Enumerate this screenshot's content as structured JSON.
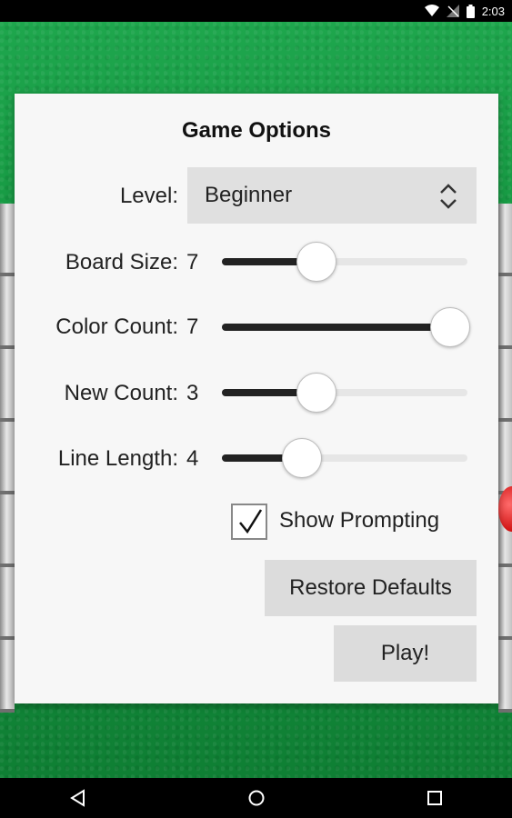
{
  "status_bar": {
    "time": "2:03"
  },
  "dialog": {
    "title": "Game Options",
    "level": {
      "label": "Level:",
      "value": "Beginner"
    },
    "board_size": {
      "label": "Board Size:",
      "value": "7",
      "level": 0.36
    },
    "color_count": {
      "label": "Color Count:",
      "value": "7",
      "level": 1.0
    },
    "new_count": {
      "label": "New Count:",
      "value": "3",
      "level": 0.36
    },
    "line_length": {
      "label": "Line Length:",
      "value": "4",
      "level": 0.29
    },
    "show_prompting": {
      "label": "Show Prompting",
      "checked": true
    },
    "restore_button": "Restore Defaults",
    "play_button": "Play!"
  },
  "colors": {
    "accent": "#222222",
    "dialog_bg": "#f7f7f7",
    "button_bg": "#dcdcdc",
    "felt": "#1ea64d"
  },
  "icons": {
    "level_dropdown": "updown-icon",
    "nav_back": "back-icon",
    "nav_home": "home-icon",
    "nav_recents": "recents-icon"
  }
}
